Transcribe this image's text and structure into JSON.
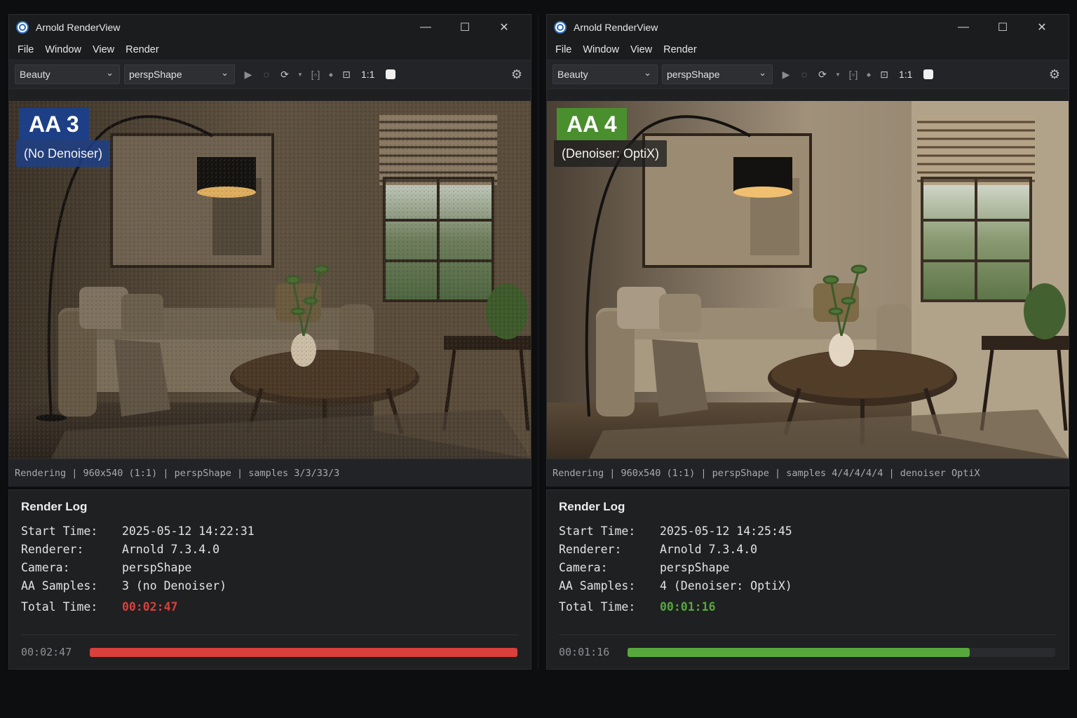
{
  "panels": [
    {
      "window_title": "Arnold RenderView",
      "menu": [
        "File",
        "Window",
        "View",
        "Render"
      ],
      "toolbar": {
        "aov": "Beauty",
        "camera": "perspShape",
        "ratio": "1:1"
      },
      "badge": {
        "main": "AA 3",
        "sub": "(No Denoiser)"
      },
      "status": "Rendering | 960x540 (1:1) | perspShape | samples 3/3/33/3",
      "log": {
        "title": "Render Log",
        "start_time_label": "Start Time:",
        "start_time": "2025-05-12 14:22:31",
        "renderer_label": "Renderer:",
        "renderer": "Arnold 7.3.4.0",
        "camera_label": "Camera:",
        "camera": "perspShape",
        "aa_label": "AA Samples:",
        "aa": "3 (no Denoiser)",
        "total_label": "Total Time:",
        "total": "00:02:47",
        "progress_time": "00:02:47",
        "progress_fraction": 1.0,
        "accent": "#d9403b"
      }
    },
    {
      "window_title": "Arnold RenderView",
      "menu": [
        "File",
        "Window",
        "View",
        "Render"
      ],
      "toolbar": {
        "aov": "Beauty",
        "camera": "perspShape",
        "ratio": "1:1"
      },
      "badge": {
        "main": "AA 4",
        "sub": "(Denoiser: OptiX)"
      },
      "status": "Rendering | 960x540 (1:1) | perspShape | samples 4/4/4/4/4 | denoiser OptiX",
      "log": {
        "title": "Render Log",
        "start_time_label": "Start Time:",
        "start_time": "2025-05-12 14:25:45",
        "renderer_label": "Renderer:",
        "renderer": "Arnold 7.3.4.0",
        "camera_label": "Camera:",
        "camera": "perspShape",
        "aa_label": "AA Samples:",
        "aa": "4 (Denoiser: OptiX)",
        "total_label": "Total Time:",
        "total": "00:01:16",
        "progress_time": "00:01:16",
        "progress_fraction": 0.8,
        "accent": "#57a83c"
      }
    }
  ],
  "colors": {
    "badge_blue": "#1d3f86",
    "badge_green": "#4a8f2e"
  },
  "icons": [
    "app-icon",
    "minimize-icon",
    "maximize-icon",
    "close-icon",
    "chevron-down-icon",
    "play-icon",
    "stop-icon",
    "refresh-icon",
    "region-icon",
    "crop-icon",
    "snapshot-icon",
    "gear-icon"
  ]
}
